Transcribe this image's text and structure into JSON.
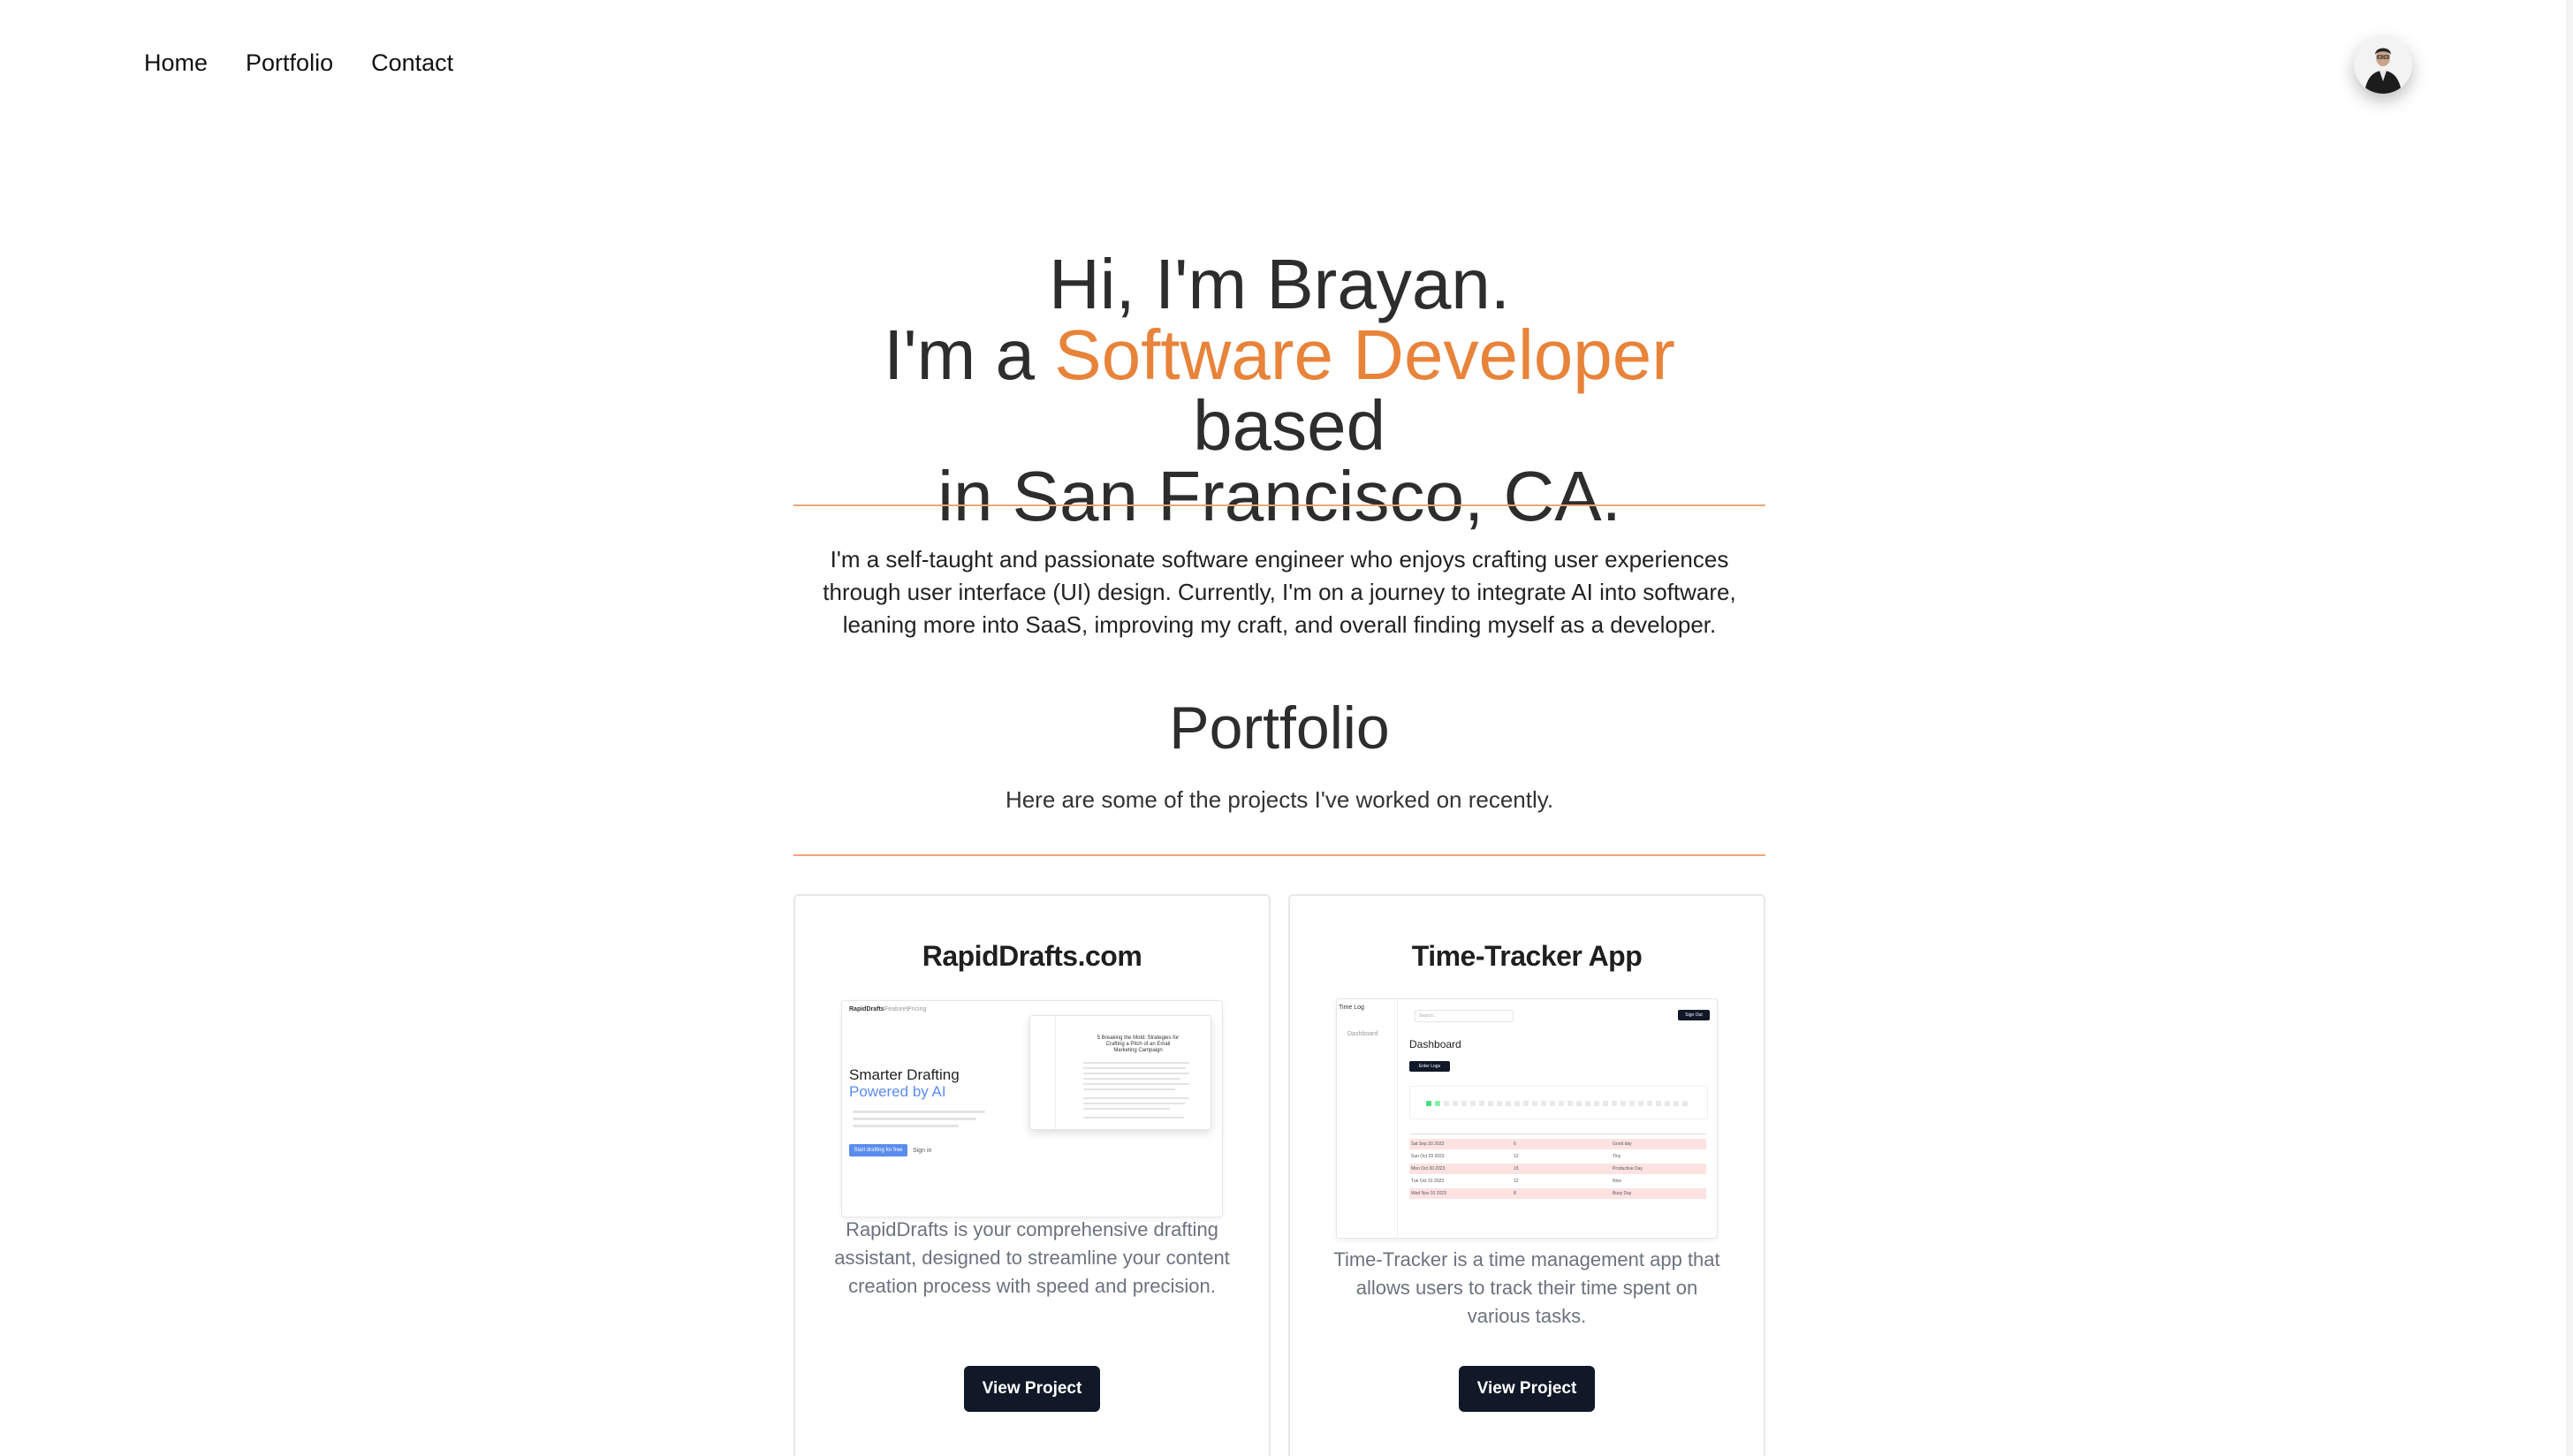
{
  "nav": {
    "items": [
      {
        "label": "Home"
      },
      {
        "label": "Portfolio"
      },
      {
        "label": "Contact"
      }
    ]
  },
  "hero": {
    "line1": "Hi, I'm Brayan.",
    "line2_prefix": "I'm a ",
    "line2_accent": "Software Developer",
    "line2_suffix": " based",
    "line3": "in San Francisco, CA.",
    "accent_color": "#e8833a"
  },
  "about": {
    "text": "I'm a self-taught and passionate software engineer who enjoys crafting user experiences through user interface (UI) design. Currently, I'm on a journey to integrate AI into software, leaning more into SaaS, improving my craft, and overall finding myself as a developer."
  },
  "portfolio": {
    "title": "Portfolio",
    "subtitle": "Here are some of the projects I've worked on recently.",
    "projects": [
      {
        "title": "RapidDrafts.com",
        "description": "RapidDrafts is your comprehensive drafting assistant, designed to streamline your content creation process with speed and precision.",
        "button": "View Project",
        "preview": {
          "brand": "RapidDrafts",
          "nav1": "Features",
          "nav2": "Pricing",
          "headline": "Smarter Drafting",
          "headline_accent": "Powered by AI",
          "cta": "Start drafting for free",
          "signin": "Sign in",
          "doc_title": "5 Breaking the Mold: Strategies for Crafting a Pitch of an Email Marketing Campaign"
        }
      },
      {
        "title": "Time-Tracker App",
        "description": "Time-Tracker is a time management app that allows users to track their time spent on various tasks.",
        "button": "View Project",
        "preview": {
          "app": "Time Log",
          "side_item": "Dashboard",
          "search": "Search...",
          "signout": "Sign Out",
          "heading": "Dashboard",
          "enter": "Enter Logs",
          "rows": [
            {
              "date": "Sat Sep 30 2023",
              "hours": "6",
              "note": "Good day"
            },
            {
              "date": "Sun Oct 29 2023",
              "hours": "12",
              "note": "Tiny"
            },
            {
              "date": "Mon Oct 30 2023",
              "hours": "15",
              "note": "Productive Day"
            },
            {
              "date": "Tue Oct 31 2023",
              "hours": "12",
              "note": "Nice"
            },
            {
              "date": "Wed Nov 01 2023",
              "hours": "8",
              "note": "Busy Day"
            }
          ]
        }
      }
    ]
  }
}
